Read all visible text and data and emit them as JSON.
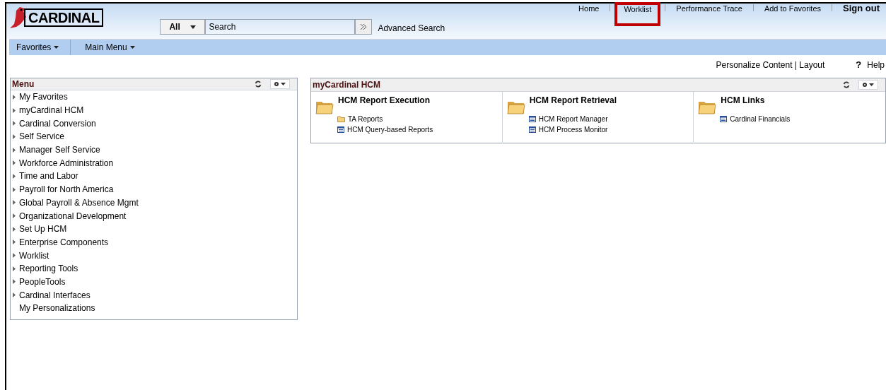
{
  "header": {
    "logo": "CARDINAL",
    "search": {
      "scope": "All",
      "placeholder": "Search",
      "advanced": "Advanced Search"
    },
    "links": [
      {
        "label": "Home",
        "highlighted": false
      },
      {
        "label": "Worklist",
        "highlighted": true
      },
      {
        "label": "Performance Trace",
        "highlighted": false
      },
      {
        "label": "Add to Favorites",
        "highlighted": false
      },
      {
        "label": "Sign out",
        "highlighted": false
      }
    ]
  },
  "nav": [
    "Favorites",
    "Main Menu"
  ],
  "page_links": {
    "personalize": "Personalize Content | Layout",
    "help_icon": "?",
    "help": "Help"
  },
  "menu": {
    "title": "Menu",
    "items": [
      {
        "label": "My Favorites",
        "expandable": true
      },
      {
        "label": "myCardinal HCM",
        "expandable": true
      },
      {
        "label": "Cardinal Conversion",
        "expandable": true
      },
      {
        "label": "Self Service",
        "expandable": true
      },
      {
        "label": "Manager Self Service",
        "expandable": true
      },
      {
        "label": "Workforce Administration",
        "expandable": true
      },
      {
        "label": "Time and Labor",
        "expandable": true
      },
      {
        "label": "Payroll for North America",
        "expandable": true
      },
      {
        "label": "Global Payroll & Absence Mgmt",
        "expandable": true
      },
      {
        "label": "Organizational Development",
        "expandable": true
      },
      {
        "label": "Set Up HCM",
        "expandable": true
      },
      {
        "label": "Enterprise Components",
        "expandable": true
      },
      {
        "label": "Worklist",
        "expandable": true
      },
      {
        "label": "Reporting Tools",
        "expandable": true
      },
      {
        "label": "PeopleTools",
        "expandable": true
      },
      {
        "label": "Cardinal Interfaces",
        "expandable": true
      },
      {
        "label": "My Personalizations",
        "expandable": false
      }
    ]
  },
  "portlet": {
    "title": "myCardinal HCM",
    "groups": [
      {
        "title": "HCM Report Execution",
        "links": [
          {
            "label": "TA Reports",
            "kind": "folder"
          },
          {
            "label": "HCM Query-based Reports",
            "kind": "page"
          }
        ]
      },
      {
        "title": "HCM Report Retrieval",
        "links": [
          {
            "label": "HCM Report Manager",
            "kind": "page"
          },
          {
            "label": "HCM Process Monitor",
            "kind": "page"
          }
        ]
      },
      {
        "title": "HCM Links",
        "links": [
          {
            "label": "Cardinal Financials",
            "kind": "page"
          }
        ]
      }
    ]
  }
}
